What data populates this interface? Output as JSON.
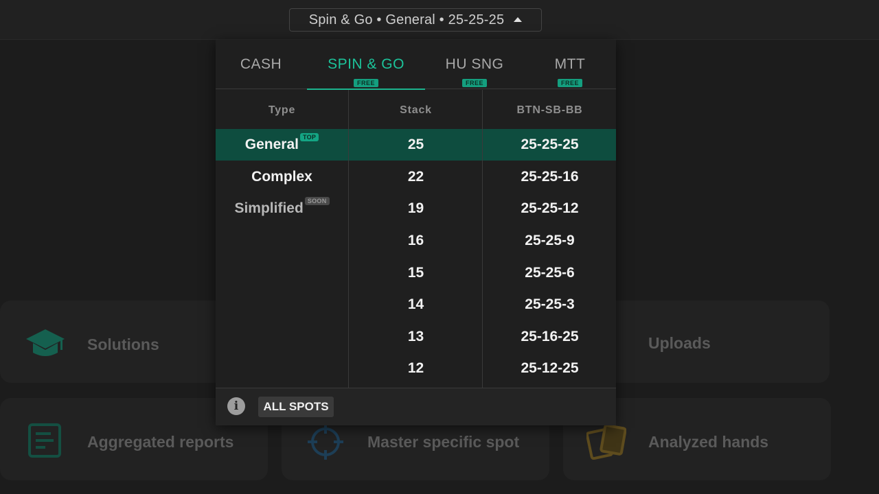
{
  "header": {
    "selector_label": "Spin & Go • General • 25-25-25"
  },
  "background_cards": {
    "solutions": "Solutions",
    "uploads": "Uploads",
    "aggregated_reports": "Aggregated reports",
    "master_specific_spot": "Master specific spot",
    "analyzed_hands": "Analyzed hands"
  },
  "tabs": [
    {
      "label": "CASH",
      "badge": ""
    },
    {
      "label": "SPIN & GO",
      "badge": "FREE"
    },
    {
      "label": "HU SNG",
      "badge": "FREE"
    },
    {
      "label": "MTT",
      "badge": "FREE"
    }
  ],
  "table": {
    "headers": {
      "type": "Type",
      "stack": "Stack",
      "positions": "BTN-SB-BB"
    },
    "types": [
      {
        "label": "General",
        "badge": "TOP"
      },
      {
        "label": "Complex",
        "badge": ""
      },
      {
        "label": "Simplified",
        "badge": "SOON"
      }
    ],
    "stacks": [
      "25",
      "22",
      "19",
      "16",
      "15",
      "14",
      "13",
      "12"
    ],
    "positions": [
      "25-25-25",
      "25-25-16",
      "25-25-12",
      "25-25-9",
      "25-25-6",
      "25-25-3",
      "25-16-25",
      "25-12-25"
    ]
  },
  "footer": {
    "info_symbol": "i",
    "all_spots_label": "ALL SPOTS"
  },
  "colors": {
    "accent": "#1cc39a",
    "highlight_row": "#0e4d3f"
  },
  "icons": [
    "caret-up-icon",
    "graduation-cap-icon",
    "report-icon",
    "crosshair-icon",
    "cards-icon",
    "info-icon"
  ]
}
